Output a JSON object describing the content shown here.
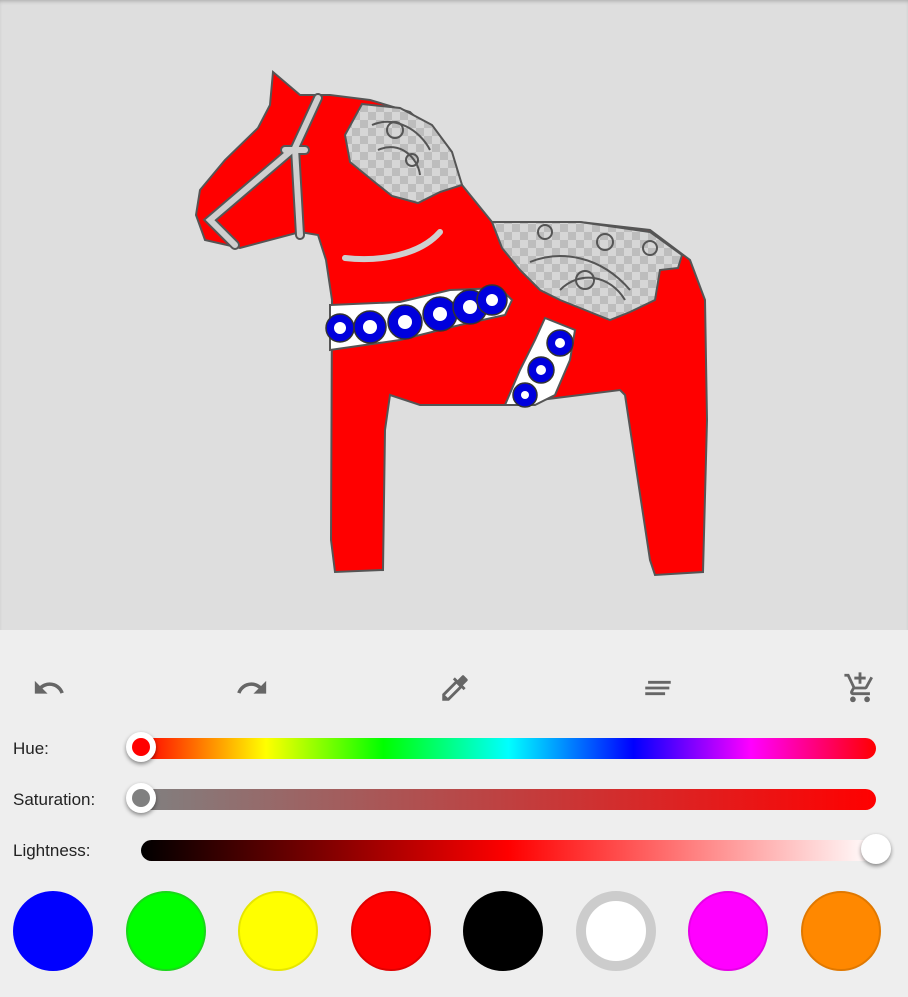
{
  "toolbar": {
    "undo_icon": "undo-icon",
    "redo_icon": "redo-icon",
    "eyedropper_icon": "eyedropper-icon",
    "menu_icon": "menu-lines-icon",
    "add_to_cart_icon": "add-shopping-cart-icon"
  },
  "sliders": {
    "hue": {
      "label": "Hue:",
      "value": 0
    },
    "saturation": {
      "label": "Saturation:",
      "value": 0
    },
    "lightness": {
      "label": "Lightness:",
      "value": 100
    }
  },
  "palette": {
    "colors": [
      "#0000ff",
      "#00ff00",
      "#ffff00",
      "#ff0000",
      "#000000",
      "#ffffff",
      "#ff00ff",
      "#ff8800"
    ]
  },
  "image": {
    "subject": "dala-horse",
    "fill_color": "#ff0000",
    "accent_color": "#0000dd"
  }
}
